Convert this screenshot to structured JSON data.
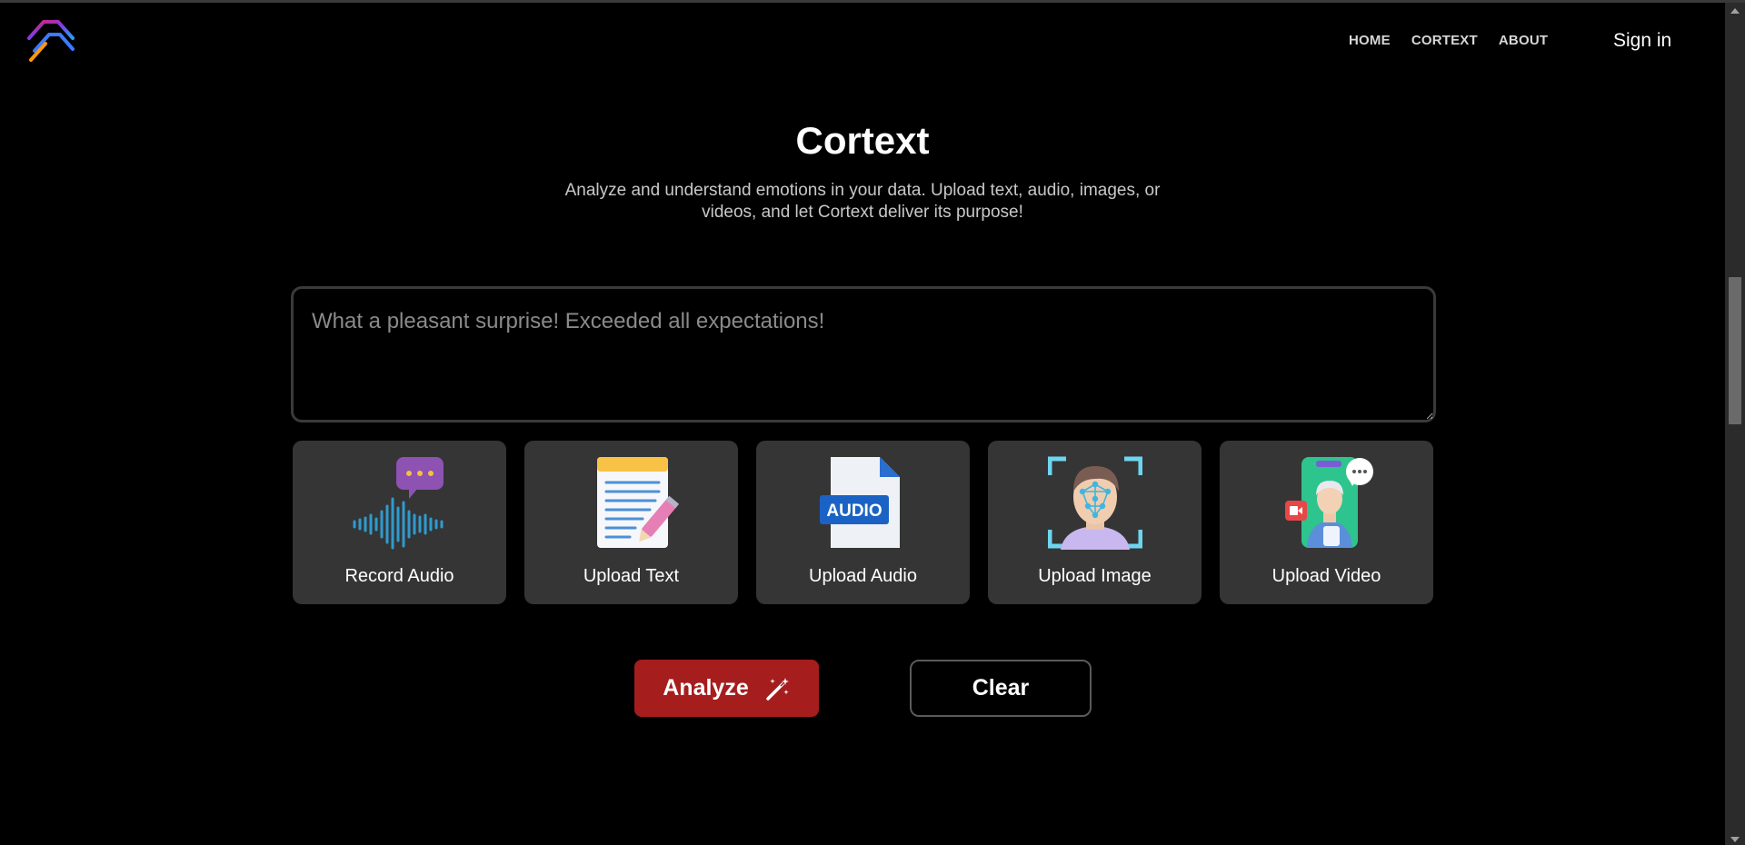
{
  "header": {
    "logo": "cortext-logo",
    "nav": [
      {
        "label": "HOME"
      },
      {
        "label": "CORTEXT"
      },
      {
        "label": "ABOUT"
      }
    ],
    "signin_label": "Sign in"
  },
  "hero": {
    "title": "Cortext",
    "subtitle": "Analyze and understand emotions in your data. Upload text, audio, images, or videos, and let Cortext deliver its purpose!"
  },
  "input": {
    "placeholder": "What a pleasant surprise! Exceeded all expectations!"
  },
  "options": [
    {
      "label": "Record Audio",
      "icon": "record-audio-icon"
    },
    {
      "label": "Upload Text",
      "icon": "document-pencil-icon"
    },
    {
      "label": "Upload Audio",
      "icon": "audio-file-icon"
    },
    {
      "label": "Upload Image",
      "icon": "face-scan-icon"
    },
    {
      "label": "Upload Video",
      "icon": "video-call-icon"
    }
  ],
  "actions": {
    "analyze_label": "Analyze",
    "clear_label": "Clear"
  },
  "colors": {
    "background": "#000000",
    "card": "#353535",
    "accent": "#a61d1d"
  }
}
